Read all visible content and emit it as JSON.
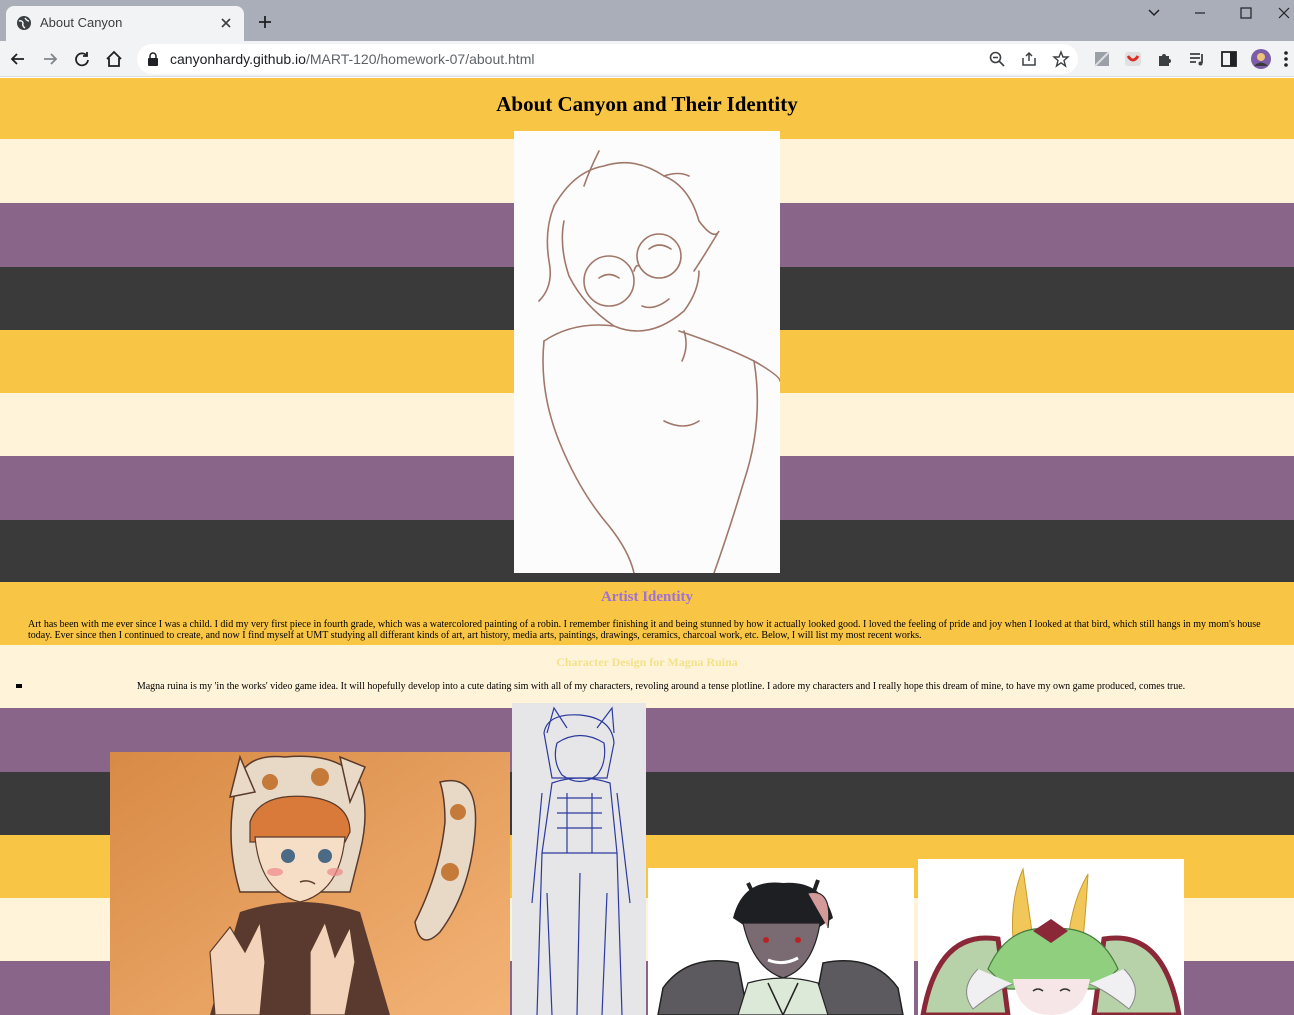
{
  "browser": {
    "tab_title": "About Canyon",
    "url_host": "canyonhardy.github.io",
    "url_path": "/MART-120/homework-07/about.html"
  },
  "page": {
    "title": "About Canyon and Their Identity",
    "section_heading": "Artist Identity",
    "paragraph": "Art has been with me ever since I was a child. I did my very first piece in fourth grade, which was a watercolored painting of a robin. I remember finishing it and being stunned by how it actually looked good. I loved the feeling of pride and joy when I looked at that bird, which still hangs in my mom's house today. Ever since then I continued to create, and now I find myself at UMT studying all differant kinds of art, art history, media arts, paintings, drawings, ceramics, charcoal work, etc. Below, I will list my most recent works.",
    "subheading": "Character Design for Magna Ruina",
    "list_items": [
      "Magna ruina is my 'in the works' video game idea. It will hopefully develop into a cute dating sim with all of my characters, revoling around a tense plotline. I adore my characters and I really hope this dream of mine, to have my own game produced, comes true."
    ]
  },
  "colors": {
    "yellow": "#f9c544",
    "cream": "#fff4da",
    "purple": "#8a658a",
    "gray": "#3a3a3a",
    "heading_purple": "#9e72d6",
    "subheading_yellow": "#f3e28a"
  }
}
